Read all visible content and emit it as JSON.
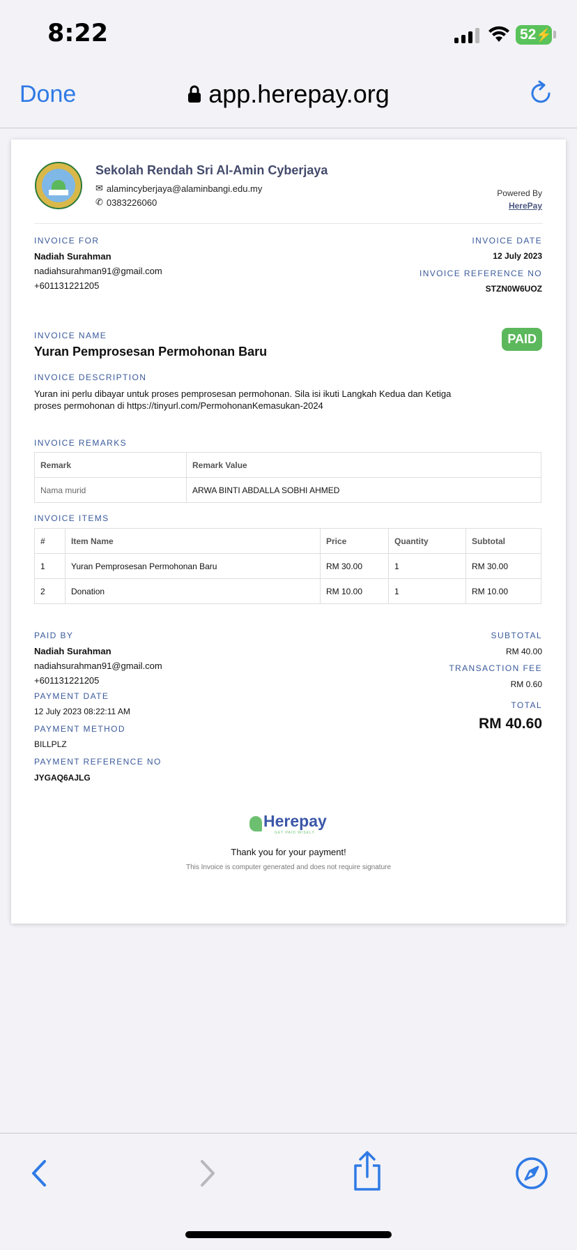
{
  "status_bar": {
    "time": "8:22",
    "battery": "52"
  },
  "browser": {
    "done_label": "Done",
    "url": "app.herepay.org"
  },
  "school": {
    "name": "Sekolah Rendah Sri Al-Amin Cyberjaya",
    "email": "alamincyberjaya@alaminbangi.edu.my",
    "phone": "0383226060"
  },
  "powered_by": {
    "label": "Powered By",
    "link": "HerePay"
  },
  "invoice_for": {
    "label": "INVOICE FOR",
    "name": "Nadiah Surahman",
    "email": "nadiahsurahman91@gmail.com",
    "phone": "+601131221205"
  },
  "invoice_date": {
    "label": "INVOICE DATE",
    "value": "12 July 2023"
  },
  "invoice_ref": {
    "label": "INVOICE REFERENCE NO",
    "value": "STZN0W6UOZ"
  },
  "invoice_name": {
    "label": "INVOICE NAME",
    "value": "Yuran Pemprosesan Permohonan Baru"
  },
  "status_badge": "PAID",
  "invoice_description": {
    "label": "INVOICE DESCRIPTION",
    "value": "Yuran ini perlu dibayar untuk proses pemprosesan permohonan. Sila isi ikuti Langkah Kedua dan Ketiga proses permohonan di https://tinyurl.com/PermohonanKemasukan-2024"
  },
  "remarks": {
    "label": "INVOICE REMARKS",
    "headers": [
      "Remark",
      "Remark Value"
    ],
    "rows": [
      [
        "Nama murid",
        "ARWA BINTI ABDALLA SOBHI AHMED"
      ]
    ]
  },
  "items": {
    "label": "INVOICE ITEMS",
    "headers": [
      "#",
      "Item Name",
      "Price",
      "Quantity",
      "Subtotal"
    ],
    "rows": [
      [
        "1",
        "Yuran Pemprosesan Permohonan Baru",
        "RM 30.00",
        "1",
        "RM 30.00"
      ],
      [
        "2",
        "Donation",
        "RM 10.00",
        "1",
        "RM 10.00"
      ]
    ]
  },
  "paid_by": {
    "label": "PAID BY",
    "name": "Nadiah Surahman",
    "email": "nadiahsurahman91@gmail.com",
    "phone": "+601131221205"
  },
  "payment_date": {
    "label": "PAYMENT DATE",
    "value": "12 July 2023 08:22:11 AM"
  },
  "payment_method": {
    "label": "PAYMENT METHOD",
    "value": "BILLPLZ"
  },
  "payment_ref": {
    "label": "PAYMENT REFERENCE NO",
    "value": "JYGAQ6AJLG"
  },
  "summary": {
    "subtotal_label": "SUBTOTAL",
    "subtotal": "RM 40.00",
    "fee_label": "TRANSACTION FEE",
    "fee": "RM 0.60",
    "total_label": "TOTAL",
    "total": "RM 40.60"
  },
  "footer": {
    "brand": "Herepay",
    "tagline": "GET PAID WISELY",
    "thanks": "Thank you for your payment!",
    "note": "This Invoice is computer generated and does not require signature"
  },
  "toolbar": {
    "back_icon": "chevron-left-icon",
    "forward_icon": "chevron-right-icon",
    "share_icon": "share-icon",
    "compass_icon": "compass-icon"
  },
  "colors": {
    "accent": "#2f7ae5",
    "label_blue": "#3a5a9a",
    "paid_green": "#5cb85c",
    "battery_green": "#5ac25a"
  }
}
